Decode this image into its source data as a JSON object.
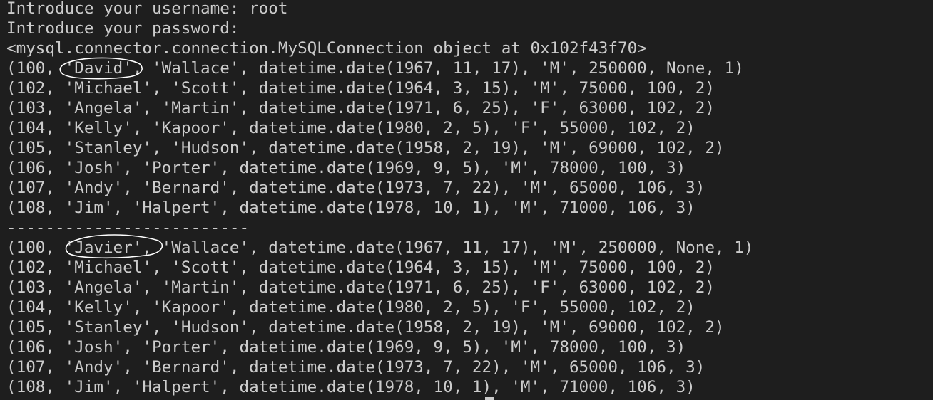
{
  "terminal": {
    "lines": [
      "Introduce your username: root",
      "Introduce your password:",
      "<mysql.connector.connection.MySQLConnection object at 0x102f43f70>",
      "(100, 'David', 'Wallace', datetime.date(1967, 11, 17), 'M', 250000, None, 1)",
      "(102, 'Michael', 'Scott', datetime.date(1964, 3, 15), 'M', 75000, 100, 2)",
      "(103, 'Angela', 'Martin', datetime.date(1971, 6, 25), 'F', 63000, 102, 2)",
      "(104, 'Kelly', 'Kapoor', datetime.date(1980, 2, 5), 'F', 55000, 102, 2)",
      "(105, 'Stanley', 'Hudson', datetime.date(1958, 2, 19), 'M', 69000, 102, 2)",
      "(106, 'Josh', 'Porter', datetime.date(1969, 9, 5), 'M', 78000, 100, 3)",
      "(107, 'Andy', 'Bernard', datetime.date(1973, 7, 22), 'M', 65000, 106, 3)",
      "(108, 'Jim', 'Halpert', datetime.date(1978, 10, 1), 'M', 71000, 106, 3)",
      "-------------------------",
      "(100, 'Javier', 'Wallace', datetime.date(1967, 11, 17), 'M', 250000, None, 1)",
      "(102, 'Michael', 'Scott', datetime.date(1964, 3, 15), 'M', 75000, 100, 2)",
      "(103, 'Angela', 'Martin', datetime.date(1971, 6, 25), 'F', 63000, 102, 2)",
      "(104, 'Kelly', 'Kapoor', datetime.date(1980, 2, 5), 'F', 55000, 102, 2)",
      "(105, 'Stanley', 'Hudson', datetime.date(1958, 2, 19), 'M', 69000, 102, 2)",
      "(106, 'Josh', 'Porter', datetime.date(1969, 9, 5), 'M', 78000, 100, 3)",
      "(107, 'Andy', 'Bernard', datetime.date(1973, 7, 22), 'M', 65000, 106, 3)",
      "(108, 'Jim', 'Halpert', datetime.date(1978, 10, 1), 'M', 71000, 106, 3)"
    ]
  },
  "colors": {
    "background": "#1e1e1e",
    "text": "#cccccc",
    "annotation": "#ffffff"
  }
}
